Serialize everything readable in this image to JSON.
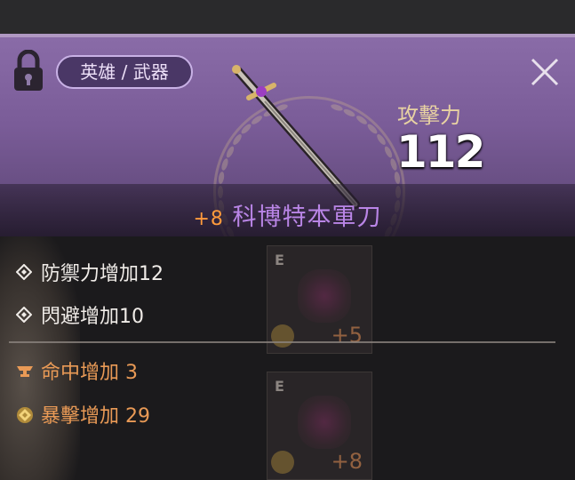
{
  "header": {
    "category": "英雄 / 武器",
    "attack_label": "攻擊力",
    "attack_value": "112",
    "item_enhance": "+8",
    "item_name": "科博特本軍刀"
  },
  "stats": {
    "sub": [
      {
        "label": "防禦力增加12",
        "icon": "diamond-outline-icon"
      },
      {
        "label": "閃避增加10",
        "icon": "diamond-outline-icon"
      }
    ],
    "special": [
      {
        "label": "命中增加 3",
        "icon": "anvil-icon"
      },
      {
        "label": "暴擊增加 29",
        "icon": "gold-diamond-icon"
      }
    ]
  },
  "background_slots": [
    {
      "tag": "E",
      "enhance": "+5"
    },
    {
      "tag": "E",
      "enhance": "+8"
    }
  ],
  "colors": {
    "header_purple": "#7a5c98",
    "item_name": "#b985e6",
    "enhance_orange": "#ff9a3c",
    "special_stat_orange": "#e99a56"
  }
}
